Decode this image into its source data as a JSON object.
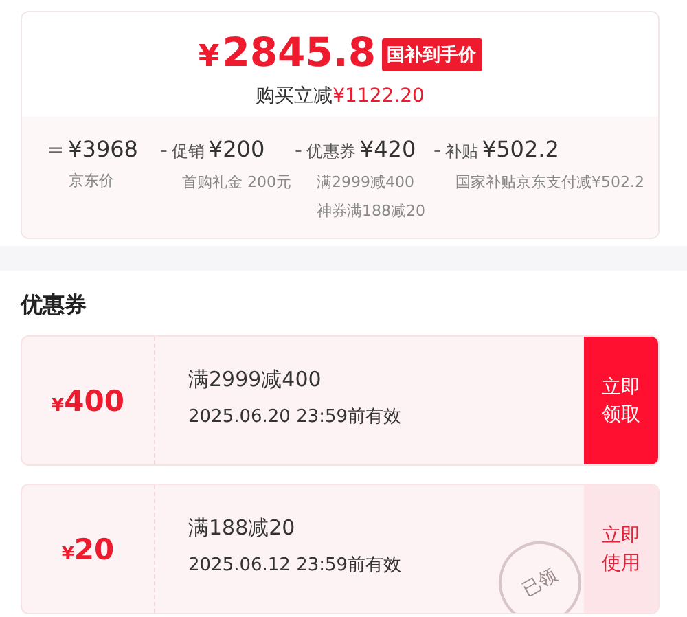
{
  "price_card": {
    "price_symbol": "¥",
    "price": "2845.8",
    "price_tag": "国补到手价",
    "saving_label": "购买立减",
    "saving_amount": "¥1122.20",
    "breakdown": [
      {
        "op": "=",
        "amount": "¥3968",
        "notes": [
          "京东价"
        ]
      },
      {
        "op": "-",
        "label": "促销",
        "amount": "¥200",
        "notes": [
          "首购礼金 200元"
        ]
      },
      {
        "op": "-",
        "label": "优惠券",
        "amount": "¥420",
        "notes": [
          "满2999减400",
          "神券满188减20"
        ]
      },
      {
        "op": "-",
        "label": "补贴",
        "amount": "¥502.2",
        "notes": [
          "国家补贴京东支付减¥502.2"
        ]
      }
    ]
  },
  "coupons_section": {
    "title": "优惠券",
    "coupons": [
      {
        "symbol": "¥",
        "amount": "400",
        "condition": "满2999减400",
        "validity": "2025.06.20 23:59前有效",
        "action": "立即领取",
        "claimed": false
      },
      {
        "symbol": "¥",
        "amount": "20",
        "condition": "满188减20",
        "validity": "2025.06.12 23:59前有效",
        "action": "立即使用",
        "claimed": true,
        "stamp": "已领"
      }
    ]
  }
}
